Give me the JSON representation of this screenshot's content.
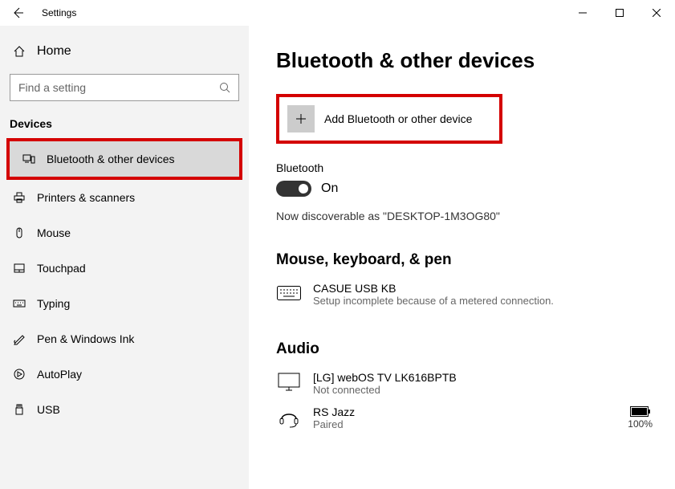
{
  "window_title": "Settings",
  "home_label": "Home",
  "search_placeholder": "Find a setting",
  "section_header": "Devices",
  "sidebar": {
    "items": [
      {
        "label": "Bluetooth & other devices"
      },
      {
        "label": "Printers & scanners"
      },
      {
        "label": "Mouse"
      },
      {
        "label": "Touchpad"
      },
      {
        "label": "Typing"
      },
      {
        "label": "Pen & Windows Ink"
      },
      {
        "label": "AutoPlay"
      },
      {
        "label": "USB"
      }
    ]
  },
  "page_title": "Bluetooth & other devices",
  "add_device_label": "Add Bluetooth or other device",
  "bluetooth_label": "Bluetooth",
  "bluetooth_state": "On",
  "discoverable_text": "Now discoverable as \"DESKTOP-1M3OG80\"",
  "section_mouse": "Mouse, keyboard, & pen",
  "kb": {
    "name": "CASUE USB KB",
    "status": "Setup incomplete because of a metered connection."
  },
  "section_audio": "Audio",
  "tv": {
    "name": "[LG] webOS TV LK616BPTB",
    "status": "Not connected"
  },
  "headset": {
    "name": "RS Jazz",
    "status": "Paired",
    "battery": "100%"
  }
}
